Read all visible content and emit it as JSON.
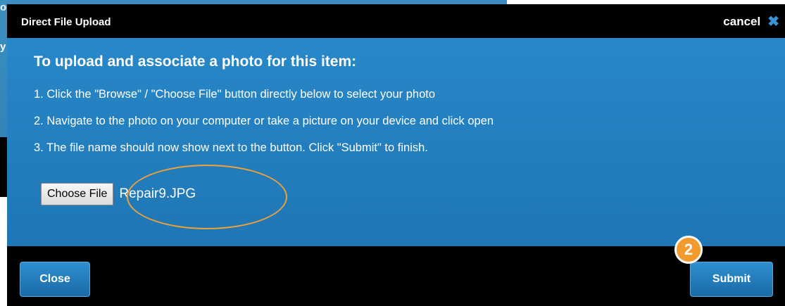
{
  "background": {
    "fragment_text_1": "or",
    "fragment_text_2": "y"
  },
  "modal": {
    "title": "Direct File Upload",
    "cancel_label": "cancel",
    "cancel_icon": "close-x-icon",
    "heading": "To upload and associate a photo for this item:",
    "steps": [
      "1. Click the \"Browse\" / \"Choose File\" button directly below to select your photo",
      "2. Navigate to the photo on your computer or take a picture on your device and click open",
      "3. The file name should now show next to the button. Click \"Submit\" to finish."
    ],
    "file_input": {
      "button_label": "Choose File",
      "file_name": "Repair9.JPG"
    },
    "footer": {
      "close_label": "Close",
      "submit_label": "Submit"
    }
  },
  "annotations": {
    "step_badge": "2",
    "highlight_color": "#f0a23a"
  },
  "colors": {
    "modal_blue": "#2888c9",
    "button_blue": "#1f7bc0",
    "badge_orange": "#f29a2e",
    "cancel_icon_blue": "#3a93d6"
  }
}
